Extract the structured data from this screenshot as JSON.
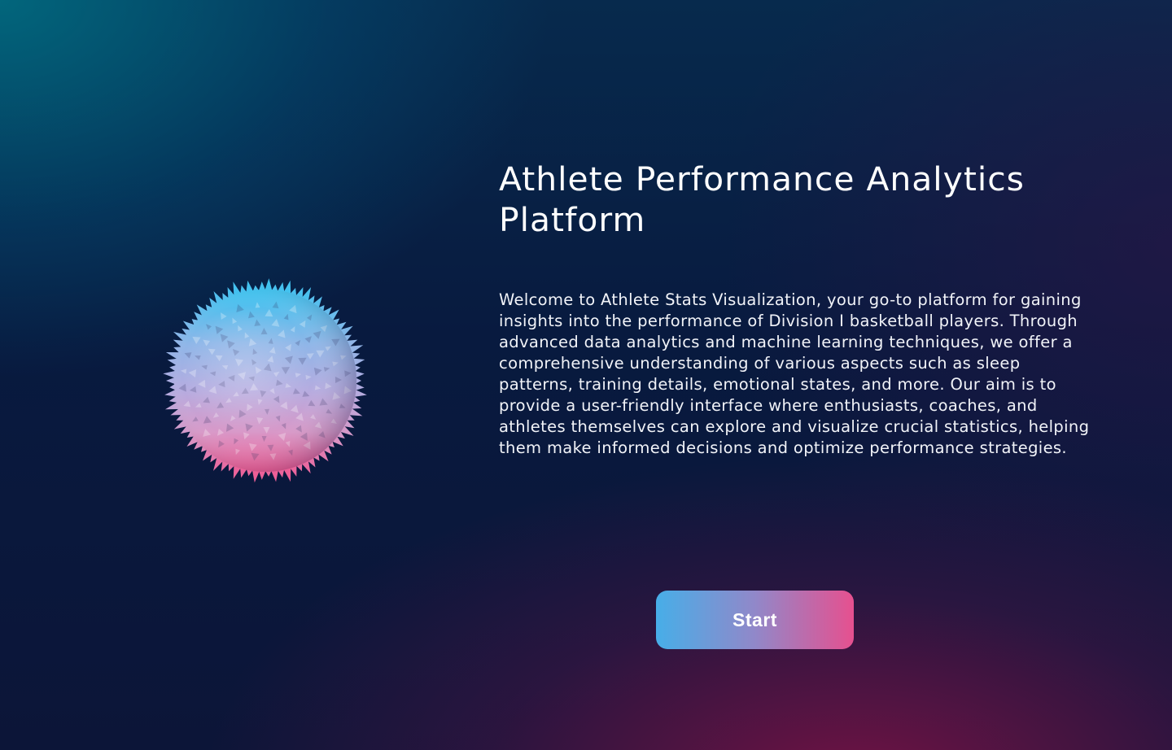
{
  "hero": {
    "title": "Athlete Performance Analytics Platform",
    "description": "Welcome to Athlete Stats Visualization, your go-to platform for gaining insights into the performance of Division I basketball players. Through advanced data analytics and machine learning techniques, we offer a comprehensive understanding of various aspects such as sleep patterns, training details, emotional states, and more. Our aim is to provide a user-friendly interface where enthusiasts, coaches, and athletes themselves can explore and visualize crucial statistics, helping them make informed decisions and optimize performance strategies.",
    "start_label": "Start",
    "visual_icon": "spiky-sphere-icon"
  },
  "colors": {
    "background_top_left": "#0a5a7a",
    "background_mid": "#081a3f",
    "background_bottom_right": "#6e1848",
    "button_gradient_start": "#47aee8",
    "button_gradient_end": "#e6508f",
    "sphere_top": "#39c3f0",
    "sphere_middle": "#a6a6e0",
    "sphere_bottom": "#f0568f"
  }
}
